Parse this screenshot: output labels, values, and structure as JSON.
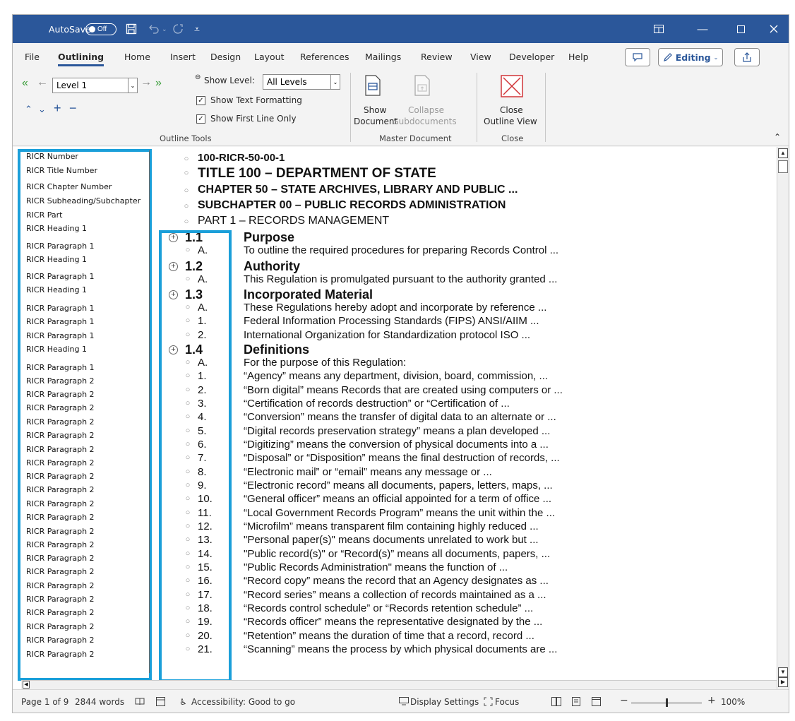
{
  "titlebar": {
    "autosave_label": "AutoSave",
    "autosave_state": "Off",
    "save_icon": "save-icon",
    "undo_icon": "undo-icon",
    "redo_icon": "redo-icon",
    "customize_icon": "customize-toolbar-icon",
    "ribbon_display_icon": "ribbon-display-icon",
    "minimize_icon": "minimize-icon",
    "maximize_icon": "maximize-icon",
    "close_icon": "close-icon",
    "bg_color": "#2b579a"
  },
  "tabs": [
    {
      "label": "File"
    },
    {
      "label": "Outlining"
    },
    {
      "label": "Home"
    },
    {
      "label": "Insert"
    },
    {
      "label": "Design"
    },
    {
      "label": "Layout"
    },
    {
      "label": "References"
    },
    {
      "label": "Mailings"
    },
    {
      "label": "Review"
    },
    {
      "label": "View"
    },
    {
      "label": "Developer"
    },
    {
      "label": "Help"
    }
  ],
  "tab_right": {
    "editing_label": "Editing"
  },
  "ribbon": {
    "level_value": "Level 1",
    "show_level_label": "Show Level:",
    "show_level_value": "All Levels",
    "show_text_formatting": "Show Text Formatting",
    "show_first_line_only": "Show First Line Only",
    "outline_tools_label": "Outline Tools",
    "show_document_1": "Show",
    "show_document_2": "Document",
    "collapse_1": "Collapse",
    "collapse_2": "Subdocuments",
    "master_document_label": "Master Document",
    "close_outline_1": "Close",
    "close_outline_2": "Outline View",
    "close_label": "Close",
    "accent": "#2b579a"
  },
  "styles": [
    "RICR Number",
    "RICR Title Number",
    "RICR Chapter Number",
    "RICR Subheading/Subchapter",
    "RICR Part",
    "RICR Heading 1",
    "RICR Paragraph 1",
    "RICR Heading 1",
    "RICR Paragraph 1",
    "RICR Heading 1",
    "RICR Paragraph 1",
    "RICR Paragraph 1",
    "RICR Paragraph 1",
    "RICR Heading 1",
    "RICR Paragraph 1",
    "RICR Paragraph 2",
    "RICR Paragraph 2",
    "RICR Paragraph 2",
    "RICR Paragraph 2",
    "RICR Paragraph 2",
    "RICR Paragraph 2",
    "RICR Paragraph 2",
    "RICR Paragraph 2",
    "RICR Paragraph 2",
    "RICR Paragraph 2",
    "RICR Paragraph 2",
    "RICR Paragraph 2",
    "RICR Paragraph 2",
    "RICR Paragraph 2",
    "RICR Paragraph 2",
    "RICR Paragraph 2",
    "RICR Paragraph 2",
    "RICR Paragraph 2",
    "RICR Paragraph 2",
    "RICR Paragraph 2",
    "RICR Paragraph 2"
  ],
  "outline": {
    "header": [
      "100-RICR-50-00-1",
      "TITLE 100 – DEPARTMENT OF STATE",
      "CHAPTER 50 – STATE ARCHIVES, LIBRARY AND PUBLIC ...",
      "SUBCHAPTER 00 – PUBLIC RECORDS ADMINISTRATION",
      "PART 1 – RECORDS MANAGEMENT"
    ],
    "rows": [
      {
        "num": "1.1",
        "text": "Purpose"
      },
      {
        "num": "A.",
        "text": "To outline the required procedures for preparing Records Control ..."
      },
      {
        "num": "1.2",
        "text": "Authority"
      },
      {
        "num": "A.",
        "text": "This Regulation is promulgated pursuant to the authority granted ..."
      },
      {
        "num": "1.3",
        "text": "Incorporated Material"
      },
      {
        "num": "A.",
        "text": "These Regulations hereby adopt and incorporate by reference ..."
      },
      {
        "num": "1.",
        "text": "Federal Information Processing Standards (FIPS) ANSI/AIIM ..."
      },
      {
        "num": "2.",
        "text": "International Organization for Standardization protocol ISO ..."
      },
      {
        "num": "1.4",
        "text": "Definitions"
      },
      {
        "num": "A.",
        "text": "For the purpose of this Regulation:"
      },
      {
        "num": "1.",
        "text": "“Agency” means any department, division, board, commission, ..."
      },
      {
        "num": "2.",
        "text": "“Born digital” means Records that are created using computers or ..."
      },
      {
        "num": "3.",
        "text": "“Certification of records destruction” or “Certification of ..."
      },
      {
        "num": "4.",
        "text": "“Conversion” means the transfer of digital data to an alternate or ..."
      },
      {
        "num": "5.",
        "text": "“Digital records preservation strategy” means a plan developed ..."
      },
      {
        "num": "6.",
        "text": "“Digitizing” means the conversion of physical documents into a ..."
      },
      {
        "num": "7.",
        "text": "“Disposal” or “Disposition” means the final destruction of records, ..."
      },
      {
        "num": "8.",
        "text": "“Electronic mail” or “email” means any message or ..."
      },
      {
        "num": "9.",
        "text": "“Electronic record” means all documents, papers, letters, maps, ..."
      },
      {
        "num": "10.",
        "text": "“General officer” means an official appointed for a term of office ..."
      },
      {
        "num": "11.",
        "text": "“Local Government Records Program” means the unit within the ..."
      },
      {
        "num": "12.",
        "text": "“Microfilm” means transparent film containing highly reduced ..."
      },
      {
        "num": "13.",
        "text": "\"Personal paper(s)\" means documents unrelated to work but ..."
      },
      {
        "num": "14.",
        "text": "\"Public record(s)\" or “Record(s)” means all documents, papers, ..."
      },
      {
        "num": "15.",
        "text": "\"Public Records Administration\" means the function of ..."
      },
      {
        "num": "16.",
        "text": "“Record copy” means the record that an Agency designates as ..."
      },
      {
        "num": "17.",
        "text": "“Record series” means a collection of records maintained as a ..."
      },
      {
        "num": "18.",
        "text": "“Records control schedule” or “Records retention schedule” ..."
      },
      {
        "num": "19.",
        "text": "“Records officer” means the representative designated by the ..."
      },
      {
        "num": "20.",
        "text": "“Retention” means the duration of time that a record, record ..."
      },
      {
        "num": "21.",
        "text": "“Scanning” means the process by which physical documents are ..."
      }
    ]
  },
  "status": {
    "page": "Page 1 of 9",
    "words": "2844 words",
    "accessibility": "Accessibility: Good to go",
    "display_settings": "Display Settings",
    "focus": "Focus",
    "zoom": "100%",
    "zoom_level_fraction": 0.5
  },
  "highlight_color": "#1b9fd9"
}
